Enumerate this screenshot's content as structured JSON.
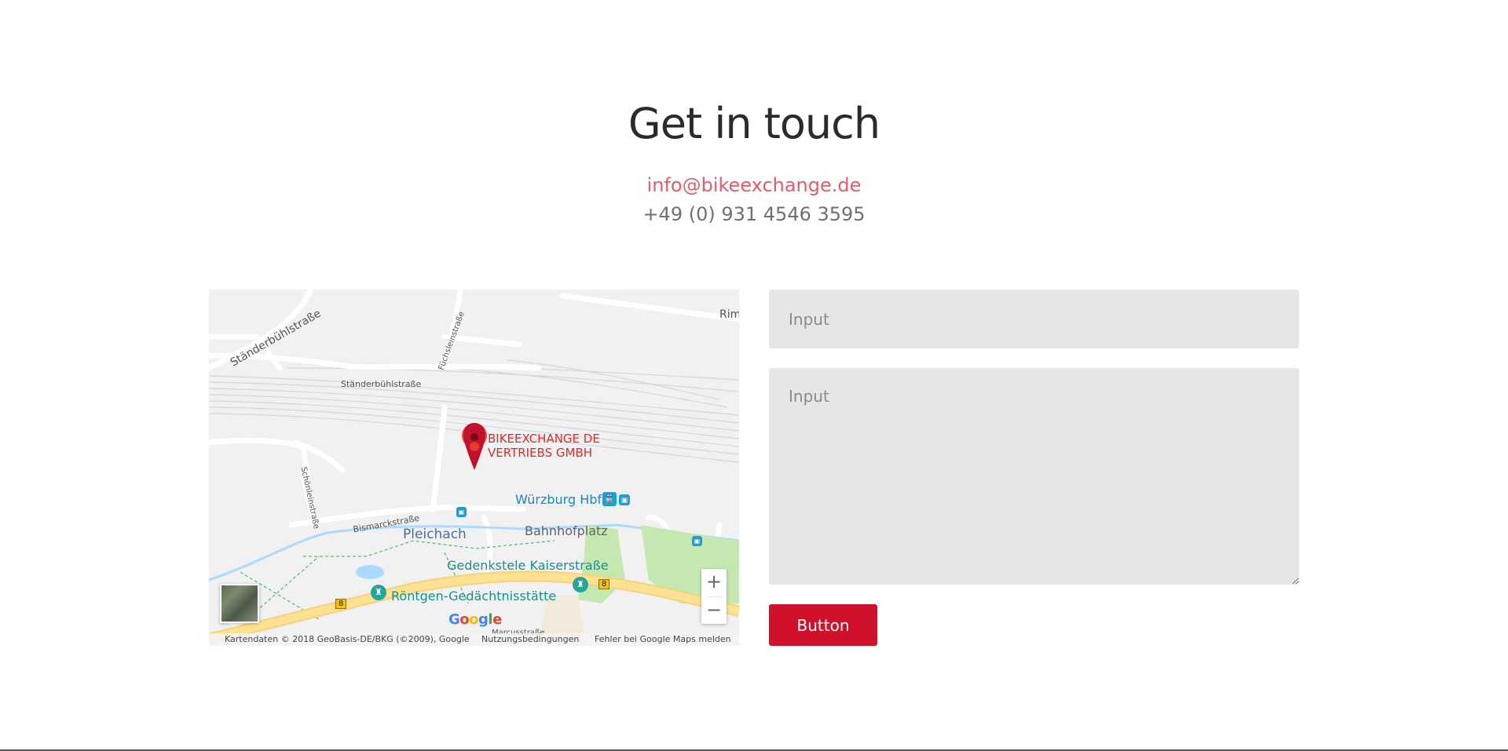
{
  "contact": {
    "heading": "Get in touch",
    "email": "info@bikeexchange.de",
    "phone": "+49 (0) 931 4546 3595"
  },
  "map": {
    "marker_label_line1": "BIKEEXCHANGE DE",
    "marker_label_line2": "VERTRIEBS GMBH",
    "streets": {
      "standerbuhlstrasse_top": "Ständerbühlstraße",
      "standerbuhlstrasse": "Ständerbühlstraße",
      "fuchsleinstrasse": "Füchsleinstraße",
      "schonleinstrasse": "Schönleinstraße",
      "bismarckstrasse": "Bismarckstraße",
      "rim": "Rim",
      "marcusstrasse": "Marcusstraße"
    },
    "places": {
      "pleichach": "Pleichach",
      "bahnhofplatz": "Bahnhofplatz",
      "wurzburg_hbf": "Würzburg Hbf",
      "gedenkstele": "Gedenkstele Kaiserstraße",
      "rontgen": "Röntgen-Gedächtnisstätte"
    },
    "road_number": "8",
    "zoom_in": "+",
    "zoom_out": "−",
    "google_logo": "Google",
    "attribution": {
      "data": "Kartendaten © 2018 GeoBasis-DE/BKG (©2009), Google",
      "terms": "Nutzungsbedingungen",
      "report": "Fehler bei Google Maps melden"
    },
    "colors": {
      "marker": "#d32f2f",
      "poi_blue": "#1a9fd6",
      "poi_teal": "#26a69a",
      "park": "#c5e8b0",
      "main_road": "#fde293",
      "water": "#aadaff"
    }
  },
  "form": {
    "input_placeholder": "Input",
    "textarea_placeholder": "Input",
    "button_label": "Button"
  },
  "colors": {
    "accent": "#d0112b",
    "email_link": "#e85a6c",
    "field_bg": "#e6e6e6"
  }
}
